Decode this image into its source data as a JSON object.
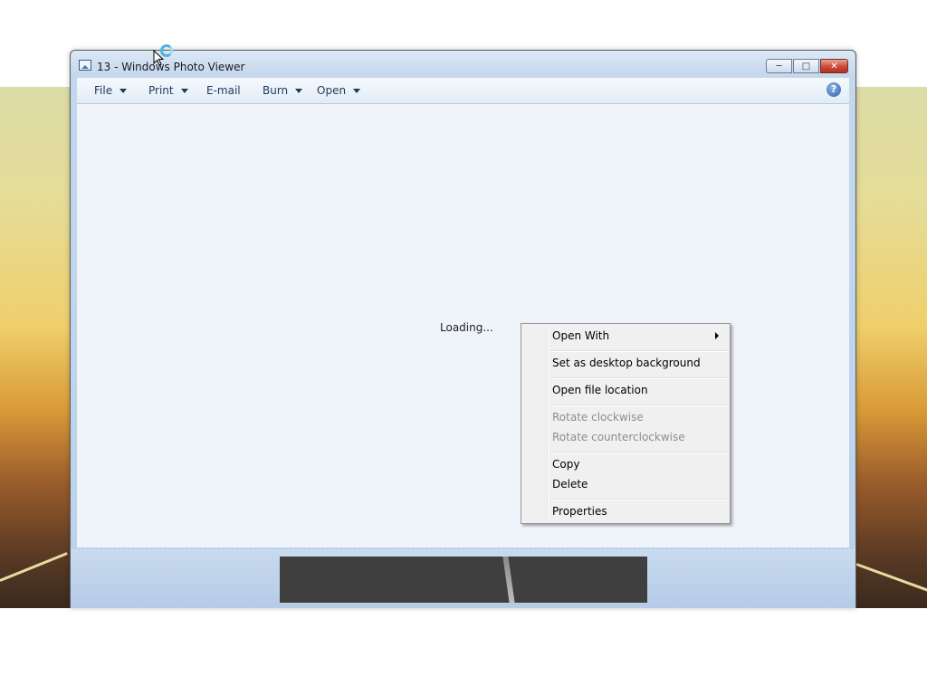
{
  "window": {
    "title": "13 - Windows Photo Viewer",
    "icon": "photo-viewer-icon",
    "controls": [
      "minimize-icon",
      "maximize-icon",
      "close-icon"
    ]
  },
  "toolbar": {
    "file": "File",
    "print": "Print",
    "email": "E-mail",
    "burn": "Burn",
    "open": "Open",
    "help": "?"
  },
  "viewer": {
    "status": "Loading..."
  },
  "context_menu": {
    "open_with": "Open With",
    "set_desktop_background": "Set as desktop background",
    "open_file_location": "Open file location",
    "rotate_clockwise": "Rotate clockwise",
    "rotate_counterclockwise": "Rotate counterclockwise",
    "copy": "Copy",
    "delete": "Delete",
    "properties": "Properties"
  },
  "colors": {
    "menu_bg": "#f0f0f0",
    "disabled_text": "#8d8d8d",
    "viewer_bg": "#eff3fa",
    "close_button": "#c94a37"
  }
}
